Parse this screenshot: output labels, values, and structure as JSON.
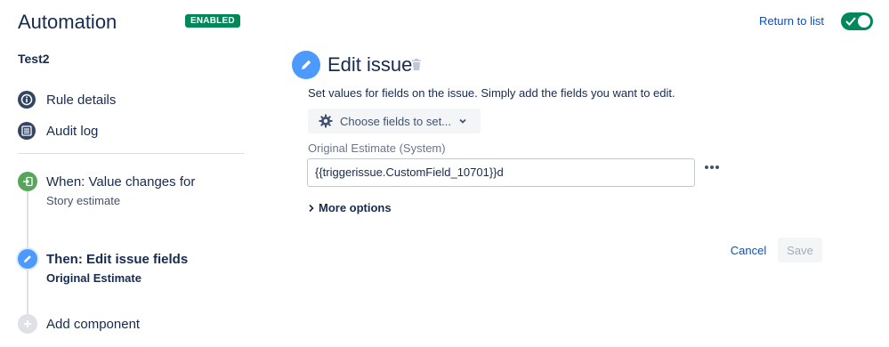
{
  "header": {
    "title": "Automation",
    "status_badge": "ENABLED",
    "return_link": "Return to list",
    "toggle_on": true
  },
  "rule": {
    "name": "Test2"
  },
  "nav": {
    "items": [
      {
        "label": "Rule details",
        "icon": "info-icon"
      },
      {
        "label": "Audit log",
        "icon": "list-icon"
      }
    ]
  },
  "timeline": {
    "trigger": {
      "title": "When: Value changes for",
      "subtitle": "Story estimate",
      "icon": "trigger-icon",
      "color": "#57a55a"
    },
    "action": {
      "title": "Then: Edit issue fields",
      "subtitle": "Original Estimate",
      "icon": "pencil-icon",
      "color": "#4c9aff"
    },
    "add": {
      "label": "Add component",
      "icon": "plus-icon"
    }
  },
  "editor": {
    "title": "Edit issue",
    "description": "Set values for fields on the issue. Simply add the fields you want to edit.",
    "choose_fields_label": "Choose fields to set...",
    "field_label": "Original Estimate (System)",
    "field_value": "{{triggerissue.CustomField_10701}}d",
    "more_options_label": "More options",
    "cancel_label": "Cancel",
    "save_label": "Save"
  },
  "colors": {
    "accent": "#0052cc",
    "enabled": "#00875a",
    "edit_blue": "#4c9aff",
    "trigger_green": "#57a55a"
  }
}
